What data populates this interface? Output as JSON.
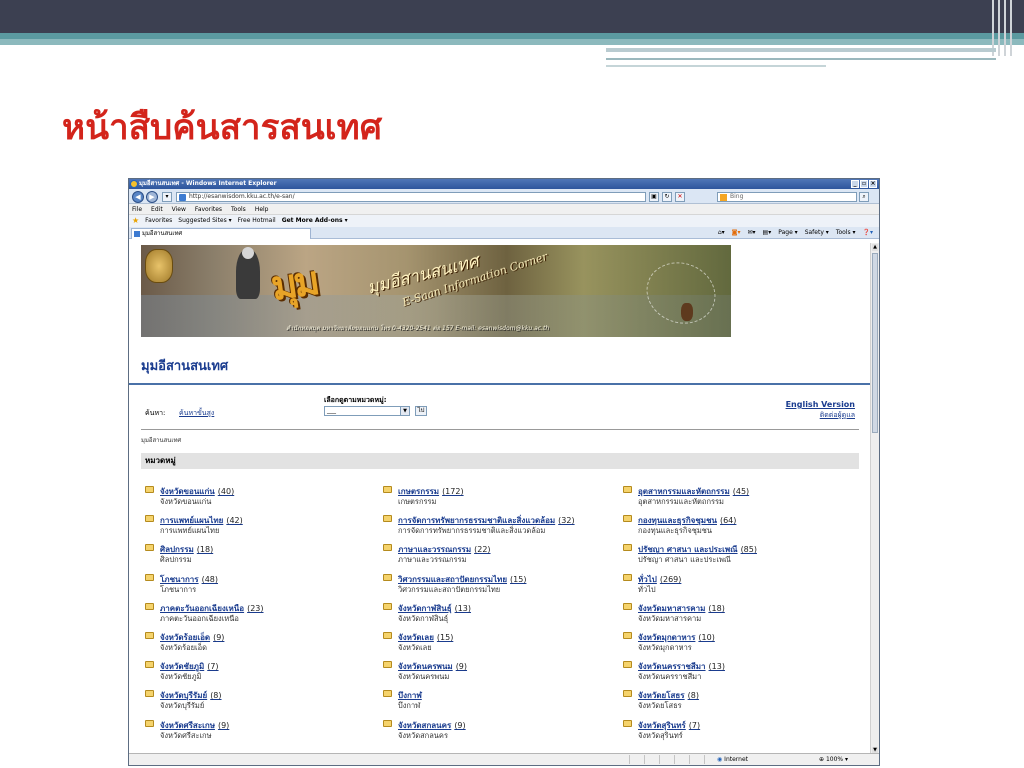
{
  "slide": {
    "title": "หน้าสืบค้นสารสนเทศ"
  },
  "window": {
    "title": "มุมอีสานสนเทศ - Windows Internet Explorer",
    "url": "http://esanwisdom.kku.ac.th/e-san/",
    "search_placeholder": "Bing",
    "menu": [
      "File",
      "Edit",
      "View",
      "Favorites",
      "Tools",
      "Help"
    ],
    "favorites": {
      "label": "Favorites",
      "items": [
        "Suggested Sites ▾",
        "Free Hotmail",
        "Get More Add-ons ▾"
      ]
    },
    "tab_title": "มุมอีสานสนเทศ",
    "commands": [
      "Page ▾",
      "Safety ▾",
      "Tools ▾"
    ],
    "status": {
      "zone": "Internet",
      "zoom": "100%"
    }
  },
  "page": {
    "banner": {
      "logo_thai": "มุมอีสานสนเทศ",
      "logo_en": "E-Saan Information Corner",
      "tagline": "สำนักหอสมุด มหาวิทยาลัยขอนแก่น   โทร 0-4320-2541 ต่อ 157   E-mail: esanwisdom@kku.ac.th"
    },
    "site_title": "มุมอีสานสนเทศ",
    "search_label": "ค้นหา:",
    "advanced_search": "ค้นหาขั้นสูง",
    "category_select_label": "เลือกดูตามหมวดหมู่:",
    "category_select_value": "___",
    "go_button": "ไป",
    "english_version": "English Version",
    "contact_us": "ติดต่อผู้ดูแล",
    "breadcrumb": "มุมอีสานสนเทศ",
    "categories_header": "หมวดหมู่",
    "categories": [
      {
        "name": "จังหวัดขอนแก่น",
        "count": "(40)",
        "sub": "จังหวัดขอนแก่น"
      },
      {
        "name": "เกษตรกรรม",
        "count": "(172)",
        "sub": "เกษตรกรรม"
      },
      {
        "name": "อุตสาหกรรมและหัตถกรรม",
        "count": "(45)",
        "sub": "อุตสาหกรรมและหัตถกรรม"
      },
      {
        "name": "การแพทย์แผนไทย",
        "count": "(42)",
        "sub": "การแพทย์แผนไทย"
      },
      {
        "name": "การจัดการทรัพยากรธรรมชาติและสิ่งแวดล้อม",
        "count": "(32)",
        "sub": "การจัดการทรัพยากรธรรมชาติและสิ่งแวดล้อม"
      },
      {
        "name": "กองทุนและธุรกิจชุมชน",
        "count": "(64)",
        "sub": "กองทุนและธุรกิจชุมชน"
      },
      {
        "name": "ศิลปกรรม",
        "count": "(18)",
        "sub": "ศิลปกรรม"
      },
      {
        "name": "ภาษาและวรรณกรรม",
        "count": "(22)",
        "sub": "ภาษาและวรรณกรรม"
      },
      {
        "name": "ปรัชญา ศาสนา และประเพณี",
        "count": "(85)",
        "sub": "ปรัชญา ศาสนา และประเพณี"
      },
      {
        "name": "โภชนาการ",
        "count": "(48)",
        "sub": "โภชนาการ"
      },
      {
        "name": "วิศวกรรมและสถาปัตยกรรมไทย",
        "count": "(15)",
        "sub": "วิศวกรรมและสถาปัตยกรรมไทย"
      },
      {
        "name": "ทั่วไป",
        "count": "(269)",
        "sub": "ทั่วไป"
      },
      {
        "name": "ภาคตะวันออกเฉียงเหนือ",
        "count": "(23)",
        "sub": "ภาคตะวันออกเฉียงเหนือ"
      },
      {
        "name": "จังหวัดกาฬสินธุ์",
        "count": "(13)",
        "sub": "จังหวัดกาฬสินธุ์"
      },
      {
        "name": "จังหวัดมหาสารคาม",
        "count": "(18)",
        "sub": "จังหวัดมหาสารคาม"
      },
      {
        "name": "จังหวัดร้อยเอ็ด",
        "count": "(9)",
        "sub": "จังหวัดร้อยเอ็ด"
      },
      {
        "name": "จังหวัดเลย",
        "count": "(15)",
        "sub": "จังหวัดเลย"
      },
      {
        "name": "จังหวัดมุกดาหาร",
        "count": "(10)",
        "sub": "จังหวัดมุกดาหาร"
      },
      {
        "name": "จังหวัดชัยภูมิ",
        "count": "(7)",
        "sub": "จังหวัดชัยภูมิ"
      },
      {
        "name": "จังหวัดนครพนม",
        "count": "(9)",
        "sub": "จังหวัดนครพนม"
      },
      {
        "name": "จังหวัดนครราชสีมา",
        "count": "(13)",
        "sub": "จังหวัดนครราชสีมา"
      },
      {
        "name": "จังหวัดบุรีรัมย์",
        "count": "(8)",
        "sub": "จังหวัดบุรีรัมย์"
      },
      {
        "name": "บึงกาฬ",
        "count": "",
        "sub": "บึงกาฬ"
      },
      {
        "name": "จังหวัดยโสธร",
        "count": "(8)",
        "sub": "จังหวัดยโสธร"
      },
      {
        "name": "จังหวัดศรีสะเกษ",
        "count": "(9)",
        "sub": "จังหวัดศรีสะเกษ"
      },
      {
        "name": "จังหวัดสกลนคร",
        "count": "(9)",
        "sub": "จังหวัดสกลนคร"
      },
      {
        "name": "จังหวัดสุรินทร์",
        "count": "(7)",
        "sub": "จังหวัดสุรินทร์"
      }
    ]
  },
  "colors": {
    "slide_title": "#d3241b",
    "link": "#1a3c8f",
    "topbar": "#3c4051",
    "teal": "#5b9aa0"
  }
}
